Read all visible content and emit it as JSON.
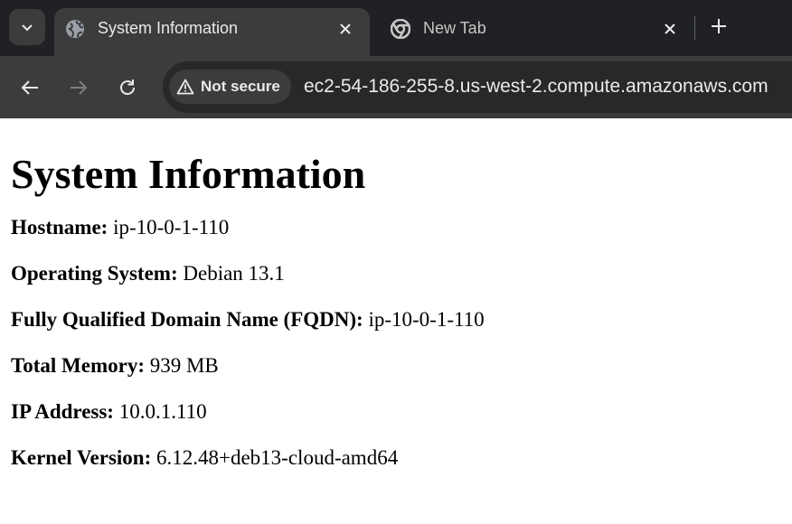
{
  "browser": {
    "tabs": [
      {
        "title": "System Information",
        "active": true,
        "favicon": "globe-icon"
      },
      {
        "title": "New Tab",
        "active": false,
        "favicon": "chrome-icon"
      }
    ],
    "security_label": "Not secure",
    "url": "ec2-54-186-255-8.us-west-2.compute.amazonaws.com"
  },
  "page": {
    "heading": "System Information",
    "fields": [
      {
        "label": "Hostname:",
        "value": "ip-10-0-1-110"
      },
      {
        "label": "Operating System:",
        "value": "Debian 13.1"
      },
      {
        "label": "Fully Qualified Domain Name (FQDN):",
        "value": "ip-10-0-1-110"
      },
      {
        "label": "Total Memory:",
        "value": "939 MB"
      },
      {
        "label": "IP Address:",
        "value": "10.0.1.110"
      },
      {
        "label": "Kernel Version:",
        "value": "6.12.48+deb13-cloud-amd64"
      }
    ]
  },
  "colors": {
    "tabstrip_bg": "#202124",
    "toolbar_bg": "#3c3c3c",
    "omnibox_bg": "#282828",
    "chrome_text": "#e8eaed"
  }
}
